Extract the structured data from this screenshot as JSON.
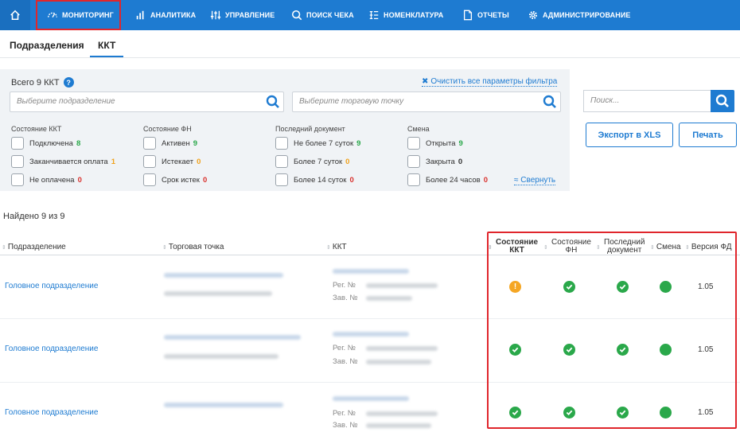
{
  "nav": {
    "items": [
      {
        "label": "МОНИТОРИНГ",
        "icon": "speedometer-icon"
      },
      {
        "label": "АНАЛИТИКА",
        "icon": "bar-chart-icon"
      },
      {
        "label": "УПРАВЛЕНИЕ",
        "icon": "sliders-icon"
      },
      {
        "label": "ПОИСК ЧЕКА",
        "icon": "search-icon"
      },
      {
        "label": "НОМЕНКЛАТУРА",
        "icon": "list-icon"
      },
      {
        "label": "ОТЧЕТЫ",
        "icon": "document-icon"
      },
      {
        "label": "АДМИНИСТРИРОВАНИЕ",
        "icon": "gear-icon"
      }
    ],
    "active_color": "#e0262c",
    "bar_color": "#1e7bd1"
  },
  "tabs": [
    {
      "label": "Подразделения"
    },
    {
      "label": "ККТ",
      "active": true
    }
  ],
  "filter": {
    "total": "Всего 9 ККТ",
    "clear": "Очистить все параметры фильтра",
    "dept_placeholder": "Выберите подразделение",
    "point_placeholder": "Выберите торговую точку",
    "collapse": "Свернуть",
    "groups": [
      {
        "title": "Состояние ККТ",
        "items": [
          {
            "label": "Подключена",
            "count": "8",
            "color": "g"
          },
          {
            "label": "Заканчивается оплата",
            "count": "1",
            "color": "o"
          },
          {
            "label": "Не оплачена",
            "count": "0",
            "color": "r"
          }
        ]
      },
      {
        "title": "Состояние ФН",
        "items": [
          {
            "label": "Активен",
            "count": "9",
            "color": "g"
          },
          {
            "label": "Истекает",
            "count": "0",
            "color": "o"
          },
          {
            "label": "Срок истек",
            "count": "0",
            "color": "r"
          }
        ]
      },
      {
        "title": "Последний документ",
        "items": [
          {
            "label": "Не более 7 суток",
            "count": "9",
            "color": "g"
          },
          {
            "label": "Более 7 суток",
            "count": "0",
            "color": "o"
          },
          {
            "label": "Более 14 суток",
            "count": "0",
            "color": "r"
          }
        ]
      },
      {
        "title": "Смена",
        "items": [
          {
            "label": "Открыта",
            "count": "9",
            "color": "g"
          },
          {
            "label": "Закрыта",
            "count": "0",
            "color": "k"
          },
          {
            "label": "Более 24 часов",
            "count": "0",
            "color": "r"
          }
        ]
      }
    ]
  },
  "search": {
    "placeholder": "Поиск..."
  },
  "buttons": {
    "export": "Экспорт в XLS",
    "print": "Печать"
  },
  "found": "Найдено 9 из 9",
  "table": {
    "headers": {
      "dept": "Подразделение",
      "point": "Торговая точка",
      "kkt": "ККТ",
      "kkt_state_1": "Состояние",
      "kkt_state_2": "ККТ",
      "fn_state_1": "Состояние",
      "fn_state_2": "ФН",
      "last_doc_1": "Последний",
      "last_doc_2": "документ",
      "shift": "Смена",
      "fd_version": "Версия ФД"
    },
    "reg_label": "Рег. №",
    "zav_label": "Зав. №",
    "rows": [
      {
        "dept": "Головное подразделение",
        "kkt_state": "warn",
        "fn": "ok",
        "doc": "ok",
        "shift": "open",
        "version": "1.05"
      },
      {
        "dept": "Головное подразделение",
        "kkt_state": "ok",
        "fn": "ok",
        "doc": "ok",
        "shift": "open",
        "version": "1.05"
      },
      {
        "dept": "Головное подразделение",
        "kkt_state": "ok",
        "fn": "ok",
        "doc": "ok",
        "shift": "open",
        "version": "1.05"
      }
    ]
  }
}
